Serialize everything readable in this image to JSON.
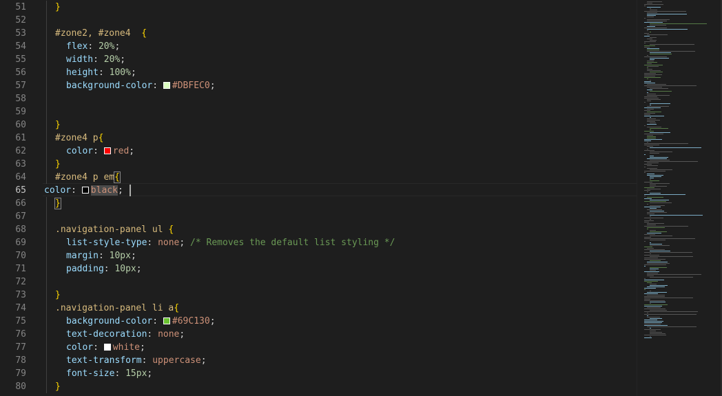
{
  "editor": {
    "language": "css",
    "active_line": 65,
    "lines": [
      {
        "n": 51,
        "indent": 1,
        "tokens": [
          [
            "}",
            "brace"
          ]
        ]
      },
      {
        "n": 52,
        "indent": 0,
        "tokens": []
      },
      {
        "n": 53,
        "indent": 1,
        "tokens": [
          [
            "#zone2, #zone4  ",
            "sel"
          ],
          [
            "{",
            "brace"
          ]
        ]
      },
      {
        "n": 54,
        "indent": 2,
        "tokens": [
          [
            "flex",
            "prop"
          ],
          [
            ": ",
            "punc"
          ],
          [
            "20%",
            "num"
          ],
          [
            ";",
            "punc"
          ]
        ]
      },
      {
        "n": 55,
        "indent": 2,
        "tokens": [
          [
            "width",
            "prop"
          ],
          [
            ": ",
            "punc"
          ],
          [
            "20%",
            "num"
          ],
          [
            ";",
            "punc"
          ]
        ]
      },
      {
        "n": 56,
        "indent": 2,
        "tokens": [
          [
            "height",
            "prop"
          ],
          [
            ": ",
            "punc"
          ],
          [
            "100%",
            "num"
          ],
          [
            ";",
            "punc"
          ]
        ]
      },
      {
        "n": 57,
        "indent": 2,
        "tokens": [
          [
            "background-color",
            "prop"
          ],
          [
            ": ",
            "punc"
          ],
          [
            "#DBFEC0",
            "swatch"
          ],
          [
            "#DBFEC0",
            "val"
          ],
          [
            ";",
            "punc"
          ]
        ]
      },
      {
        "n": 58,
        "indent": 0,
        "tokens": []
      },
      {
        "n": 59,
        "indent": 0,
        "tokens": []
      },
      {
        "n": 60,
        "indent": 1,
        "tokens": [
          [
            "}",
            "brace"
          ]
        ]
      },
      {
        "n": 61,
        "indent": 1,
        "tokens": [
          [
            "#zone4 p",
            "sel"
          ],
          [
            "{",
            "brace"
          ]
        ]
      },
      {
        "n": 62,
        "indent": 2,
        "tokens": [
          [
            "color",
            "prop"
          ],
          [
            ": ",
            "punc"
          ],
          [
            "#ff0000",
            "swatch"
          ],
          [
            "red",
            "val"
          ],
          [
            ";",
            "punc"
          ]
        ]
      },
      {
        "n": 63,
        "indent": 1,
        "tokens": [
          [
            "}",
            "brace"
          ]
        ]
      },
      {
        "n": 64,
        "indent": 1,
        "tokens": [
          [
            "#zone4 p em",
            "sel"
          ],
          [
            "{",
            "brace-hl"
          ]
        ]
      },
      {
        "n": 65,
        "indent": 0,
        "tokens": [
          [
            "color",
            "prop"
          ],
          [
            ": ",
            "punc"
          ],
          [
            "#000000",
            "swatch"
          ],
          [
            "black",
            "val-hl"
          ],
          [
            ";",
            "punc"
          ]
        ]
      },
      {
        "n": 66,
        "indent": 1,
        "tokens": [
          [
            "}",
            "brace-hl"
          ]
        ]
      },
      {
        "n": 67,
        "indent": 0,
        "tokens": []
      },
      {
        "n": 68,
        "indent": 1,
        "tokens": [
          [
            ".navigation-panel ul ",
            "sel"
          ],
          [
            "{",
            "brace"
          ]
        ]
      },
      {
        "n": 69,
        "indent": 2,
        "tokens": [
          [
            "list-style-type",
            "prop"
          ],
          [
            ": ",
            "punc"
          ],
          [
            "none",
            "val"
          ],
          [
            "; ",
            "punc"
          ],
          [
            "/* Removes the default list styling */",
            "com"
          ]
        ]
      },
      {
        "n": 70,
        "indent": 2,
        "tokens": [
          [
            "margin",
            "prop"
          ],
          [
            ": ",
            "punc"
          ],
          [
            "10px",
            "num"
          ],
          [
            ";",
            "punc"
          ]
        ]
      },
      {
        "n": 71,
        "indent": 2,
        "tokens": [
          [
            "padding",
            "prop"
          ],
          [
            ": ",
            "punc"
          ],
          [
            "10px",
            "num"
          ],
          [
            ";",
            "punc"
          ]
        ]
      },
      {
        "n": 72,
        "indent": 0,
        "tokens": []
      },
      {
        "n": 73,
        "indent": 1,
        "tokens": [
          [
            "}",
            "brace"
          ]
        ]
      },
      {
        "n": 74,
        "indent": 1,
        "tokens": [
          [
            ".navigation-panel li a",
            "sel"
          ],
          [
            "{",
            "brace"
          ]
        ]
      },
      {
        "n": 75,
        "indent": 2,
        "tokens": [
          [
            "background-color",
            "prop"
          ],
          [
            ": ",
            "punc"
          ],
          [
            "#69C130",
            "swatch"
          ],
          [
            "#69C130",
            "val"
          ],
          [
            ";",
            "punc"
          ]
        ]
      },
      {
        "n": 76,
        "indent": 2,
        "tokens": [
          [
            "text-decoration",
            "prop"
          ],
          [
            ": ",
            "punc"
          ],
          [
            "none",
            "val"
          ],
          [
            ";",
            "punc"
          ]
        ]
      },
      {
        "n": 77,
        "indent": 2,
        "tokens": [
          [
            "color",
            "prop"
          ],
          [
            ": ",
            "punc"
          ],
          [
            "#ffffff",
            "swatch"
          ],
          [
            "white",
            "val"
          ],
          [
            ";",
            "punc"
          ]
        ]
      },
      {
        "n": 78,
        "indent": 2,
        "tokens": [
          [
            "text-transform",
            "prop"
          ],
          [
            ": ",
            "punc"
          ],
          [
            "uppercase",
            "val"
          ],
          [
            ";",
            "punc"
          ]
        ]
      },
      {
        "n": 79,
        "indent": 2,
        "tokens": [
          [
            "font-size",
            "prop"
          ],
          [
            ": ",
            "punc"
          ],
          [
            "15px",
            "num"
          ],
          [
            ";",
            "punc"
          ]
        ]
      },
      {
        "n": 80,
        "indent": 1,
        "tokens": [
          [
            "}",
            "brace"
          ]
        ]
      }
    ]
  },
  "colors": {
    "background": "#1e1e1e",
    "selector": "#d7ba7d",
    "brace": "#ffd700",
    "property": "#9cdcfe",
    "number": "#b5cea8",
    "value": "#ce9178",
    "comment": "#6a9955"
  }
}
